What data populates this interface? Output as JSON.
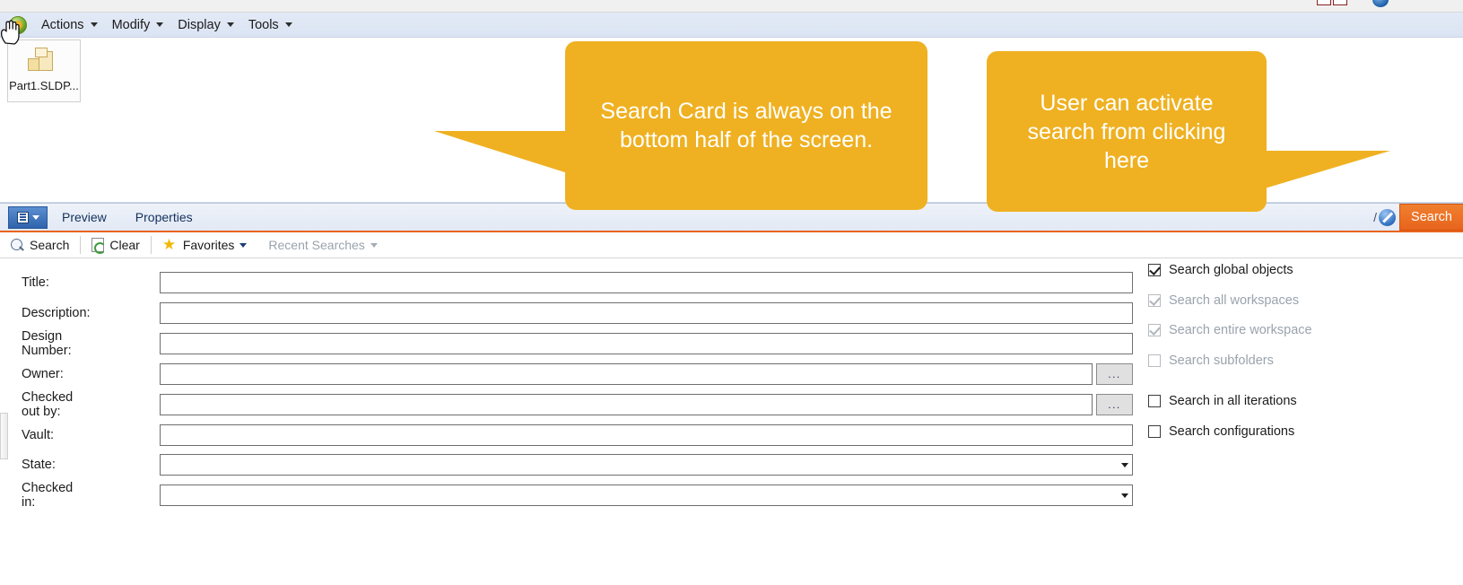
{
  "window": {
    "chrome_icons": [
      "window-icon-a",
      "window-icon-b",
      "help-globe-icon"
    ]
  },
  "menubar": {
    "app_icon": "solidworks-pdm-icon",
    "items": [
      {
        "label": "Actions",
        "icon": "chevron-down-icon"
      },
      {
        "label": "Modify",
        "icon": "chevron-down-icon"
      },
      {
        "label": "Display",
        "icon": "chevron-down-icon"
      },
      {
        "label": "Tools",
        "icon": "chevron-down-icon"
      }
    ]
  },
  "filepane": {
    "file": {
      "name": "Part1.SLDP...",
      "icon": "3d-part-icon"
    }
  },
  "cardbar": {
    "menu_button_icon": "list-menu-icon",
    "menu_button_caret": "chevron-down-icon",
    "tabs": [
      {
        "label": "Preview"
      },
      {
        "label": "Properties"
      }
    ],
    "right": {
      "separator_text": "/",
      "no_entry_icon": "no-entry-icon",
      "search_button": "Search"
    }
  },
  "searchtoolbar": {
    "items": [
      {
        "label": "Search",
        "icon": "magnifier-icon",
        "disabled": false,
        "caret": false
      },
      {
        "label": "Clear",
        "icon": "clear-refresh-icon",
        "disabled": false,
        "caret": false
      },
      {
        "label": "Favorites",
        "icon": "star-icon",
        "disabled": false,
        "caret": true
      },
      {
        "label": "Recent Searches",
        "icon": "none",
        "disabled": true,
        "caret": true
      }
    ]
  },
  "form": {
    "fields": [
      {
        "label": "Title:",
        "type": "text",
        "value": "",
        "browse": false
      },
      {
        "label": "Description:",
        "type": "text",
        "value": "",
        "browse": false
      },
      {
        "label": "Design Number:",
        "type": "text",
        "value": "",
        "browse": false
      },
      {
        "label": "Owner:",
        "type": "text",
        "value": "",
        "browse": true,
        "browse_label": "..."
      },
      {
        "label": "Checked out by:",
        "type": "text",
        "value": "",
        "browse": true,
        "browse_label": "..."
      },
      {
        "label": "Vault:",
        "type": "text",
        "value": "",
        "browse": false
      },
      {
        "label": "State:",
        "type": "select",
        "value": "",
        "browse": false
      },
      {
        "label": "Checked in:",
        "type": "select",
        "value": "",
        "browse": false
      }
    ]
  },
  "options": {
    "checkboxes": [
      {
        "label": "Search global objects",
        "checked": true,
        "disabled": false,
        "gap_after": false
      },
      {
        "label": "Search all workspaces",
        "checked": true,
        "disabled": true,
        "gap_after": false
      },
      {
        "label": "Search entire workspace",
        "checked": true,
        "disabled": true,
        "gap_after": false
      },
      {
        "label": "Search subfolders",
        "checked": false,
        "disabled": true,
        "gap_after": true
      },
      {
        "label": "Search in all iterations",
        "checked": false,
        "disabled": false,
        "gap_after": false
      },
      {
        "label": "Search configurations",
        "checked": false,
        "disabled": false,
        "gap_after": false
      }
    ]
  },
  "callouts": [
    {
      "text": "Search Card is always on the bottom half of the screen."
    },
    {
      "text": "User can activate search from clicking here"
    }
  ],
  "colors": {
    "callout": "#efb122",
    "accent_orange": "#e8641c",
    "tab_blue": "#2f63ac"
  }
}
